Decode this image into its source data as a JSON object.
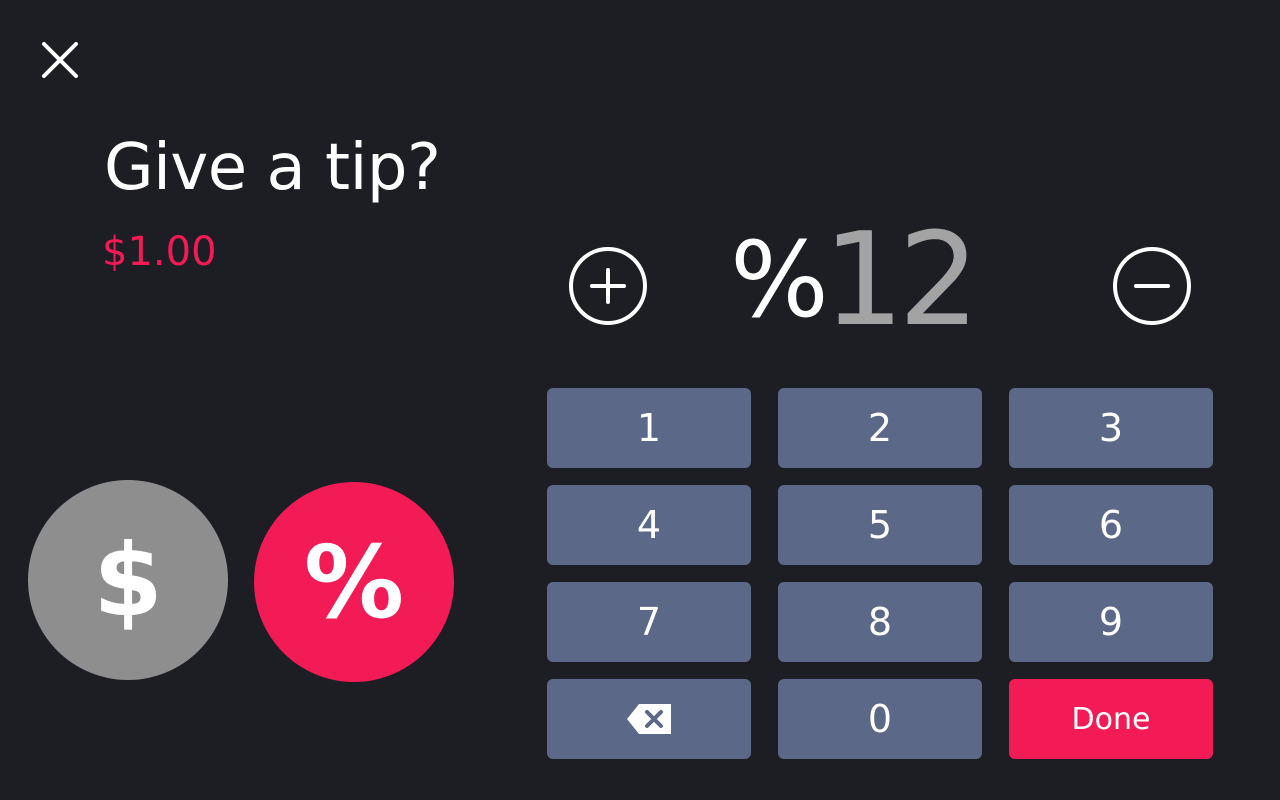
{
  "header": {
    "close_icon": "close-icon",
    "title": "Give a tip?",
    "tip_amount": "$1.00"
  },
  "mode_toggle": {
    "dollar_label": "$",
    "percent_label": "%",
    "selected": "percent",
    "colors": {
      "inactive": "#8e8e8e",
      "active": "#f21b55"
    }
  },
  "stepper": {
    "increment_icon": "plus-circle-icon",
    "decrement_icon": "minus-circle-icon",
    "unit": "%",
    "value": "12"
  },
  "keypad": {
    "keys": [
      "1",
      "2",
      "3",
      "4",
      "5",
      "6",
      "7",
      "8",
      "9"
    ],
    "backspace_icon": "backspace-icon",
    "zero_label": "0",
    "done_label": "Done"
  },
  "colors": {
    "background": "#1c1e23",
    "accent": "#f21b55",
    "key": "#5b6887"
  }
}
